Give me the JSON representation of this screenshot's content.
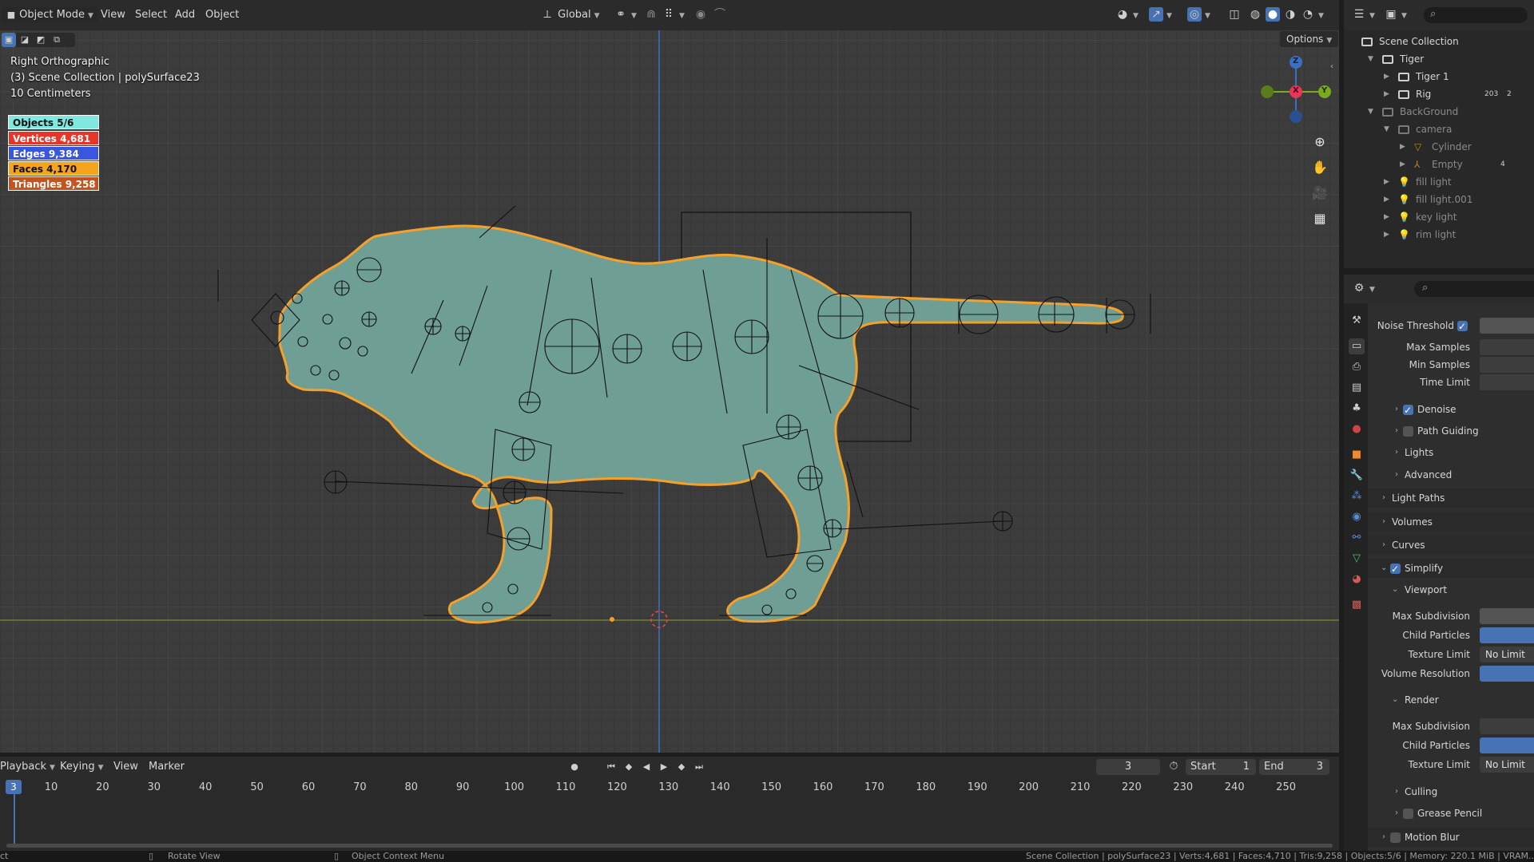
{
  "header": {
    "mode": "Object Mode",
    "menus": [
      "View",
      "Select",
      "Add",
      "Object"
    ],
    "transform_orientation": "Global",
    "options": "Options"
  },
  "viewport": {
    "view_name": "Right Orthographic",
    "collection_info": "(3) Scene Collection | polySurface23",
    "scale_info": "10 Centimeters",
    "stats": {
      "objects": "Objects 5/6",
      "vertices": "Vertices  4,681",
      "edges": "Edges 9,384",
      "faces": "Faces 4,170",
      "triangles": "Triangles 9,258"
    },
    "stat_colors": {
      "objects": "#7fe9e0",
      "vertices": "#e8352a",
      "edges": "#3a55e0",
      "faces": "#f5a41c",
      "triangles": "#c4541e"
    },
    "gizmo": {
      "z": "Z",
      "x": "X",
      "y": "Y"
    }
  },
  "timeline": {
    "menus": [
      "Playback",
      "Keying",
      "View",
      "Marker"
    ],
    "current_frame": "3",
    "start_label": "Start",
    "start_value": "1",
    "end_label": "End",
    "end_value": "3",
    "ruler_current": "3",
    "ruler": [
      "10",
      "20",
      "30",
      "40",
      "50",
      "60",
      "70",
      "80",
      "90",
      "100",
      "110",
      "120",
      "130",
      "140",
      "150",
      "160",
      "170",
      "180",
      "190",
      "200",
      "210",
      "220",
      "230",
      "240",
      "250"
    ]
  },
  "statusbar": {
    "left": "ct",
    "rotate": "Rotate View",
    "context": "Object Context Menu",
    "right": "Scene Collection | polySurface23 | Verts:4,681 | Faces:4,710 | Tris:9,258 | Objects:5/6 | Memory: 220.1 MiB | VRAM..."
  },
  "outliner": {
    "root": "Scene Collection",
    "items": [
      {
        "label": "Tiger",
        "level": 1,
        "expanded": true,
        "kind": "collection"
      },
      {
        "label": "Tiger 1",
        "level": 2,
        "expanded": false,
        "kind": "collection"
      },
      {
        "label": "Rig",
        "level": 2,
        "expanded": false,
        "kind": "collection",
        "badge": "203",
        "badge2": "2"
      },
      {
        "label": "BackGround",
        "level": 1,
        "expanded": true,
        "kind": "collection",
        "dim": true
      },
      {
        "label": "camera",
        "level": 2,
        "expanded": true,
        "kind": "collection",
        "dim": true
      },
      {
        "label": "Cylinder",
        "level": 3,
        "expanded": false,
        "kind": "mesh",
        "dim": true
      },
      {
        "label": "Empty",
        "level": 3,
        "expanded": false,
        "kind": "empty",
        "dim": true,
        "badge": "4"
      },
      {
        "label": "fill light",
        "level": 2,
        "expanded": false,
        "kind": "light",
        "dim": true
      },
      {
        "label": "fill light.001",
        "level": 2,
        "expanded": false,
        "kind": "light",
        "dim": true
      },
      {
        "label": "key light",
        "level": 2,
        "expanded": false,
        "kind": "light",
        "dim": true
      },
      {
        "label": "rim light",
        "level": 2,
        "expanded": false,
        "kind": "light",
        "dim": true
      }
    ]
  },
  "properties": {
    "noise_threshold": "Noise Threshold",
    "max_samples": "Max Samples",
    "min_samples": "Min Samples",
    "time_limit": "Time Limit",
    "denoise": "Denoise",
    "path_guiding": "Path Guiding",
    "lights": "Lights",
    "advanced": "Advanced",
    "light_paths": "Light Paths",
    "volumes": "Volumes",
    "curves": "Curves",
    "simplify": "Simplify",
    "viewport": "Viewport",
    "vp_max_subdivision": "Max Subdivision",
    "vp_child_particles": "Child Particles",
    "vp_texture_limit": "Texture Limit",
    "vp_texture_limit_value": "No Limit",
    "vp_volume_resolution": "Volume Resolution",
    "render": "Render",
    "r_max_subdivision": "Max Subdivision",
    "r_child_particles": "Child Particles",
    "r_texture_limit": "Texture Limit",
    "r_texture_limit_value": "No Limit",
    "culling": "Culling",
    "grease_pencil": "Grease Pencil",
    "motion_blur": "Motion Blur"
  }
}
